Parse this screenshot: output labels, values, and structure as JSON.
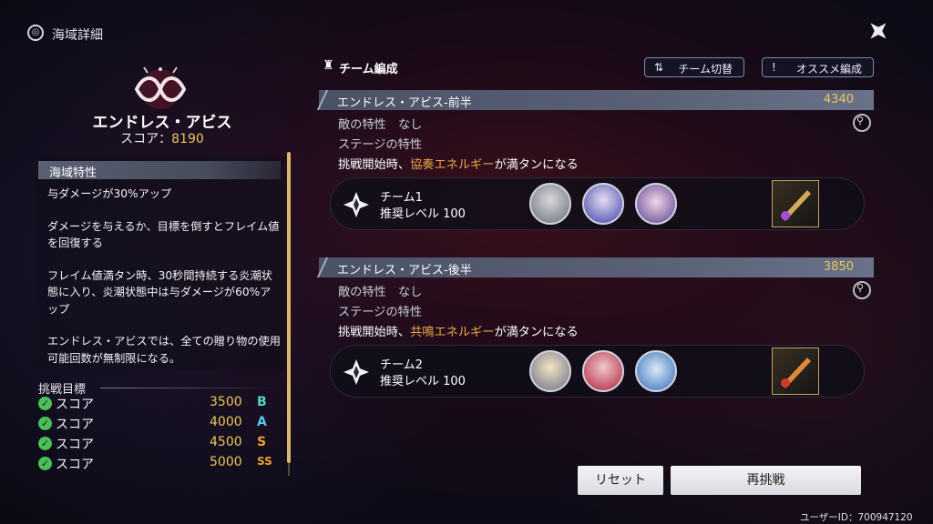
{
  "header": {
    "title": "海域詳細",
    "icon": "sea-area-icon"
  },
  "stage": {
    "name": "エンドレス・アビス",
    "score_label": "スコア：",
    "score_value": "8190"
  },
  "sea_traits": {
    "title": "海域特性",
    "paragraphs": [
      "与ダメージが30%アップ",
      "ダメージを与えるか、目標を倒すとフレイム値を回復する",
      "フレイム値満タン時、30秒間持続する炎潮状態に入り、炎潮状態中は与ダメージが60%アップ",
      "エンドレス・アビスでは、全ての贈り物の使用可能回数が無制限になる。"
    ]
  },
  "goals": {
    "title": "挑戦目標",
    "rows": [
      {
        "label": "スコア",
        "value": "3500",
        "rank": "B",
        "color": "#4fd6c2"
      },
      {
        "label": "スコア",
        "value": "4000",
        "rank": "A",
        "color": "#56c7f0"
      },
      {
        "label": "スコア",
        "value": "4500",
        "rank": "S",
        "color": "#f0a030"
      },
      {
        "label": "スコア",
        "value": "5000",
        "rank": "SS",
        "color": "#f0a030"
      }
    ]
  },
  "team_section": {
    "label": "チーム編成",
    "switch_button": "チーム切替",
    "switch_glyph": "⇅",
    "recommend_button": "オススメ編成",
    "recommend_glyph": "!"
  },
  "stages": [
    {
      "name": "エンドレス・アビス-前半",
      "score": "4340",
      "enemy_trait_label": "敵の特性",
      "enemy_trait_value": "なし",
      "stage_trait_label": "ステージの特性",
      "effect_prefix": "挑戦開始時、",
      "effect_highlight": "協奏エネルギー",
      "effect_suffix": "が満タンになる",
      "team_name": "チーム1",
      "team_level": "推奨レベル 100"
    },
    {
      "name": "エンドレス・アビス-後半",
      "score": "3850",
      "enemy_trait_label": "敵の特性",
      "enemy_trait_value": "なし",
      "stage_trait_label": "ステージの特性",
      "effect_prefix": "挑戦開始時、",
      "effect_highlight": "共鳴エネルギー",
      "effect_suffix": "が満タンになる",
      "team_name": "チーム2",
      "team_level": "推奨レベル 100"
    }
  ],
  "footer": {
    "reset_button": "リセット",
    "retry_button": "再挑戦",
    "user_id": "ユーザーID：700947120"
  }
}
